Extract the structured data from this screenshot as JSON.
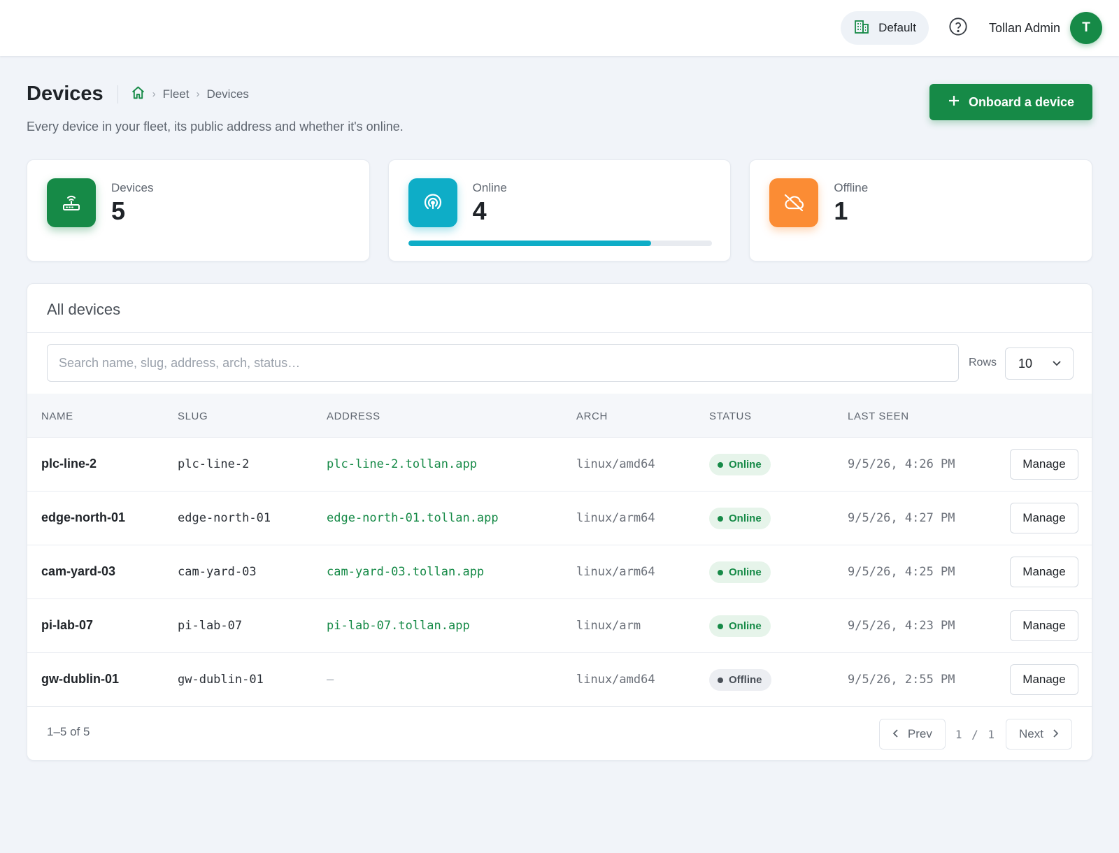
{
  "topbar": {
    "workspace_label": "Default",
    "user_name": "Tollan Admin",
    "avatar_initial": "T"
  },
  "header": {
    "title": "Devices",
    "breadcrumb": [
      "Fleet",
      "Devices"
    ],
    "subtitle": "Every device in your fleet, its public address and whether it's online.",
    "onboard_label": "Onboard a device"
  },
  "stats": [
    {
      "label": "Devices",
      "value": "5",
      "icon": "router-icon",
      "color": "#168a47"
    },
    {
      "label": "Online",
      "value": "4",
      "icon": "signal-icon",
      "color": "#0eadc7",
      "progress_percent": 80
    },
    {
      "label": "Offline",
      "value": "1",
      "icon": "cloud-off-icon",
      "color": "#fb8c34"
    }
  ],
  "table": {
    "title": "All devices",
    "search_placeholder": "Search name, slug, address, arch, status…",
    "rows_label": "Rows",
    "rows_value": "10",
    "columns": [
      "NAME",
      "SLUG",
      "ADDRESS",
      "ARCH",
      "STATUS",
      "LAST SEEN"
    ],
    "rows": [
      {
        "name": "plc-line-2",
        "slug": "plc-line-2",
        "address": "plc-line-2.tollan.app",
        "arch": "linux/amd64",
        "status": "Online",
        "last_seen": "9/5/26, 4:26 PM",
        "action": "Manage"
      },
      {
        "name": "edge-north-01",
        "slug": "edge-north-01",
        "address": "edge-north-01.tollan.app",
        "arch": "linux/arm64",
        "status": "Online",
        "last_seen": "9/5/26, 4:27 PM",
        "action": "Manage"
      },
      {
        "name": "cam-yard-03",
        "slug": "cam-yard-03",
        "address": "cam-yard-03.tollan.app",
        "arch": "linux/arm64",
        "status": "Online",
        "last_seen": "9/5/26, 4:25 PM",
        "action": "Manage"
      },
      {
        "name": "pi-lab-07",
        "slug": "pi-lab-07",
        "address": "pi-lab-07.tollan.app",
        "arch": "linux/arm",
        "status": "Online",
        "last_seen": "9/5/26, 4:23 PM",
        "action": "Manage"
      },
      {
        "name": "gw-dublin-01",
        "slug": "gw-dublin-01",
        "address": "–",
        "arch": "linux/amd64",
        "status": "Offline",
        "last_seen": "9/5/26, 2:55 PM",
        "action": "Manage"
      }
    ],
    "footer": {
      "range_text": "1–5 of 5",
      "prev_label": "Prev",
      "page_indicator": "1 / 1",
      "next_label": "Next"
    }
  }
}
